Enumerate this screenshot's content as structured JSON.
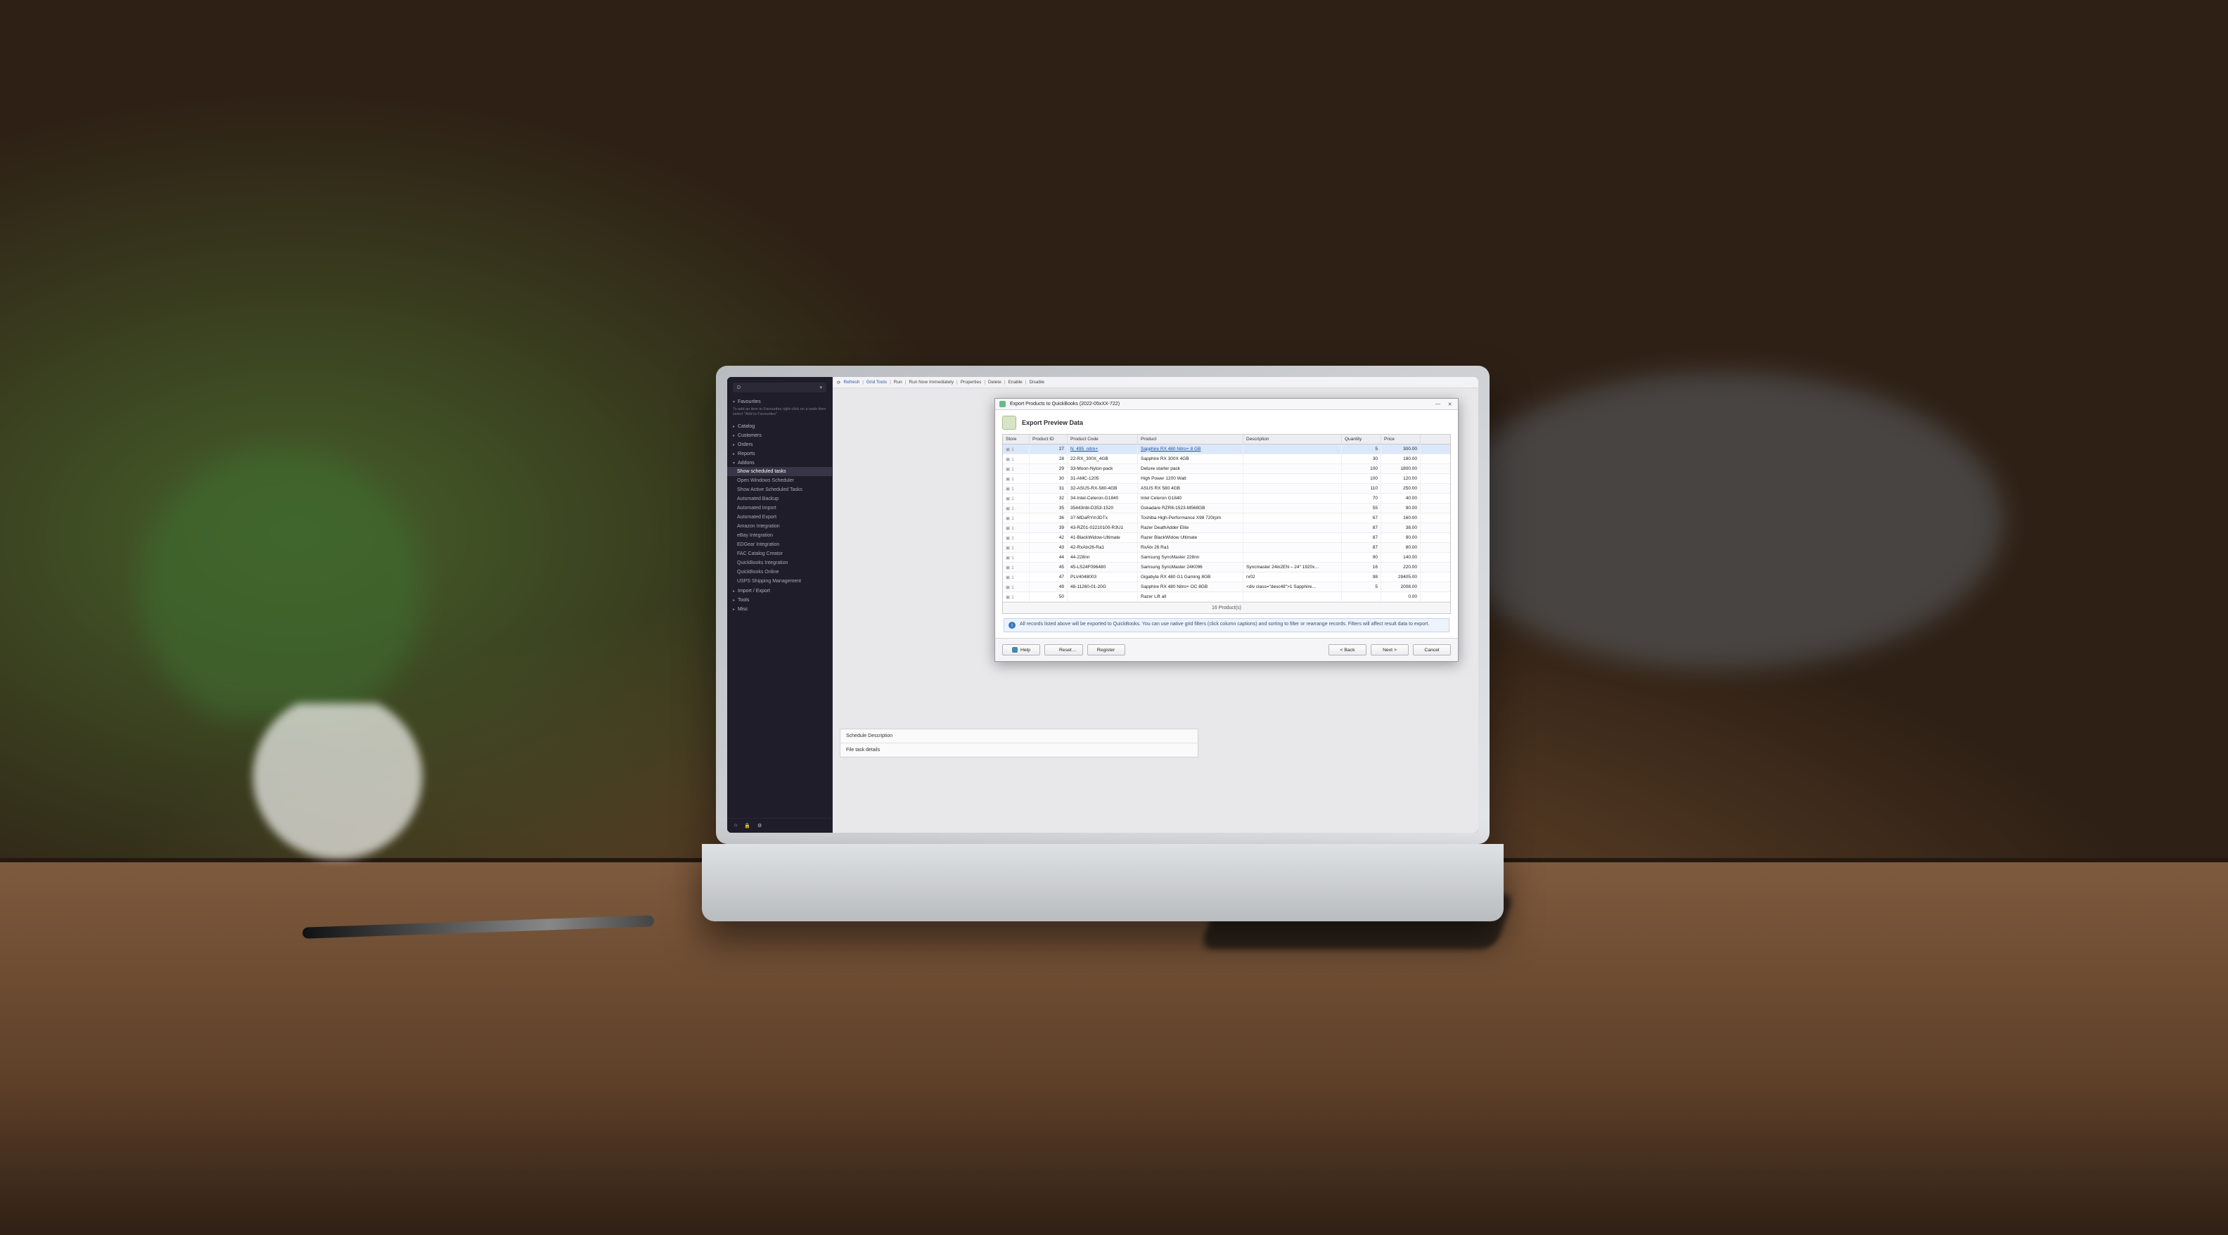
{
  "sidebar": {
    "selector_placeholder": "D",
    "favourites_label": "Favourites",
    "favourites_tip": "To add an item to Favourites right-click on a node then select \"Add to Favourites\"",
    "sections": {
      "catalog": "Catalog",
      "customers": "Customers",
      "orders": "Orders",
      "reports": "Reports",
      "addons": "Addons",
      "import_export": "Import / Export",
      "tools": "Tools",
      "misc": "Misc"
    },
    "addons_items": [
      "Show scheduled tasks",
      "Open Windows Scheduler",
      "Show Active Scheduled Tasks",
      "Automated Backup",
      "Automated Import",
      "Automated Export",
      "Amazon Integration",
      "eBay Integration",
      "EDGear Integration",
      "FAC Catalog Creator",
      "QuickBooks Integration",
      "QuickBooks Online",
      "USPS Shipping Management"
    ],
    "addons_active_index": 0
  },
  "breadcrumb": {
    "items": [
      "Refresh",
      "Grid Tools",
      "Run",
      "Run Now Immediately",
      "Properties",
      "Delete",
      "Enable",
      "Disable"
    ]
  },
  "schedule_panel": {
    "label_description": "Schedule Description",
    "value_description": "",
    "label_details": "File task details",
    "value_details": ""
  },
  "modal": {
    "title": "Export Products to QuickBooks (2022-05xXX-722)",
    "heading": "Export Preview Data",
    "columns": [
      "Store",
      "Product ID",
      "Product Code",
      "Product",
      "Description",
      "Quantity",
      "Price"
    ],
    "rows": [
      {
        "store": "1",
        "pid": "27",
        "code": "N_495_nitro+",
        "product": "Sapphire RX 480 Nitro+ 8 GB",
        "desc": "",
        "qty": "5",
        "price": "300.00",
        "selected": true
      },
      {
        "store": "1",
        "pid": "28",
        "code": "22-RX_300X_4GB",
        "product": "Sapphire RX 300X 4GB",
        "desc": "",
        "qty": "30",
        "price": "180.00"
      },
      {
        "store": "1",
        "pid": "29",
        "code": "33-Moon-Nylon-pack",
        "product": "Deluxe starter pack",
        "desc": "",
        "qty": "100",
        "price": "1800.00"
      },
      {
        "store": "1",
        "pid": "30",
        "code": "31-AMC-1205",
        "product": "High Power 1200 Watt",
        "desc": "",
        "qty": "100",
        "price": "120.00"
      },
      {
        "store": "1",
        "pid": "31",
        "code": "32-ASUS-RX-580-4GB",
        "product": "ASUS RX 580 4GB",
        "desc": "",
        "qty": "110",
        "price": "250.00"
      },
      {
        "store": "1",
        "pid": "32",
        "code": "34-Intel-Celeron-G1840",
        "product": "Intel Celeron G1840",
        "desc": "",
        "qty": "70",
        "price": "40.00"
      },
      {
        "store": "1",
        "pid": "35",
        "code": "35443nbl-D353-1520",
        "product": "Gskadare RZR6-1523-M568GB",
        "desc": "",
        "qty": "55",
        "price": "90.00"
      },
      {
        "store": "1",
        "pid": "36",
        "code": "37-MDaRYm3DTx",
        "product": "Toshiba High-Performance X98 720rpm",
        "desc": "",
        "qty": "67",
        "price": "160.00"
      },
      {
        "store": "1",
        "pid": "39",
        "code": "43-RZ01-02210100-R3U1",
        "product": "Razer DeathAdder Elite",
        "desc": "",
        "qty": "87",
        "price": "38.00"
      },
      {
        "store": "1",
        "pid": "42",
        "code": "41-BlackWidow-Ultimate",
        "product": "Razer BlackWidow Ultimate",
        "desc": "",
        "qty": "87",
        "price": "90.00"
      },
      {
        "store": "1",
        "pid": "43",
        "code": "42-RxAtx26-Ra1",
        "product": "RxAtx 26 Ra1",
        "desc": "",
        "qty": "87",
        "price": "80.00"
      },
      {
        "store": "1",
        "pid": "44",
        "code": "44-228nn",
        "product": "Samsung SyncMaster 228nn",
        "desc": "",
        "qty": "90",
        "price": "140.00"
      },
      {
        "store": "1",
        "pid": "45",
        "code": "45-LS24F096480",
        "product": "Samsung SyncMaster 24K096",
        "desc": "Syncmaster 24in2EN – 24\" 1920x…",
        "qty": "16",
        "price": "220.00"
      },
      {
        "store": "1",
        "pid": "47",
        "code": "PLV4048003",
        "product": "Gigabyte RX 480 G1 Gaming 8GB",
        "desc": "rx02",
        "qty": "98",
        "price": "29405.00"
      },
      {
        "store": "1",
        "pid": "49",
        "code": "48-11260-01-20G",
        "product": "Sapphire RX 480 Nitro+ OC 8GB",
        "desc": "<div class=\"desc48\">1 Sapphire…",
        "qty": "5",
        "price": "2008.00"
      },
      {
        "store": "1",
        "pid": "50",
        "code": "",
        "product": "Razer Lift all",
        "desc": "",
        "qty": "",
        "price": "0.00"
      }
    ],
    "footer_count": "16 Product(s)",
    "info_note": "All records listed above will be exported to QuickBooks. You can use native grid filters (click column captions) and sorting to filter or rearrange records. Filters will affect result data to export.",
    "buttons": {
      "help": "Help",
      "reset": "Reset…",
      "register": "Register",
      "back": "< Back",
      "next": "Next >",
      "cancel": "Cancel"
    }
  }
}
